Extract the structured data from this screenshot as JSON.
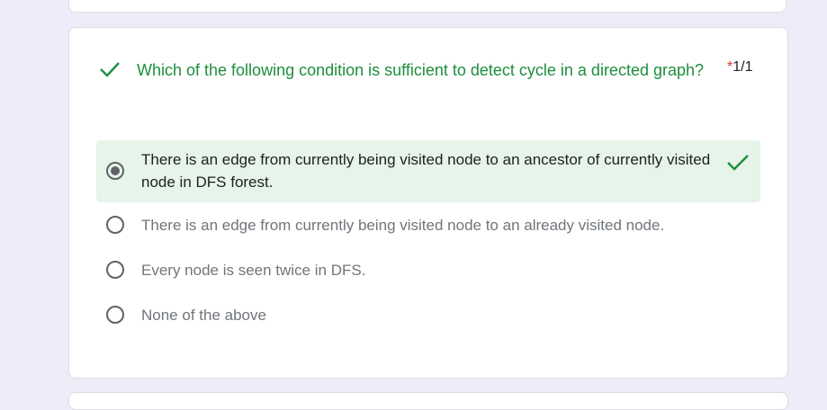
{
  "question": {
    "title": "Which of the following condition is sufficient to detect cycle in a directed graph?",
    "required_mark": "*",
    "score": "1/1",
    "status": "correct",
    "status_icon": "check-icon",
    "accent_color": "#1e8e3e"
  },
  "options": [
    {
      "label": "There is an edge from currently being visited node to an ancestor of currently visited node in DFS forest.",
      "selected": true,
      "correct": true
    },
    {
      "label": "There is an edge from currently being visited node to an already visited node.",
      "selected": false,
      "correct": false
    },
    {
      "label": "Every node is seen twice in DFS.",
      "selected": false,
      "correct": false
    },
    {
      "label": "None of the above",
      "selected": false,
      "correct": false
    }
  ],
  "colors": {
    "page_background": "#f0ebf8",
    "correct_highlight": "#e6f4ea",
    "required_star": "#d93025"
  }
}
